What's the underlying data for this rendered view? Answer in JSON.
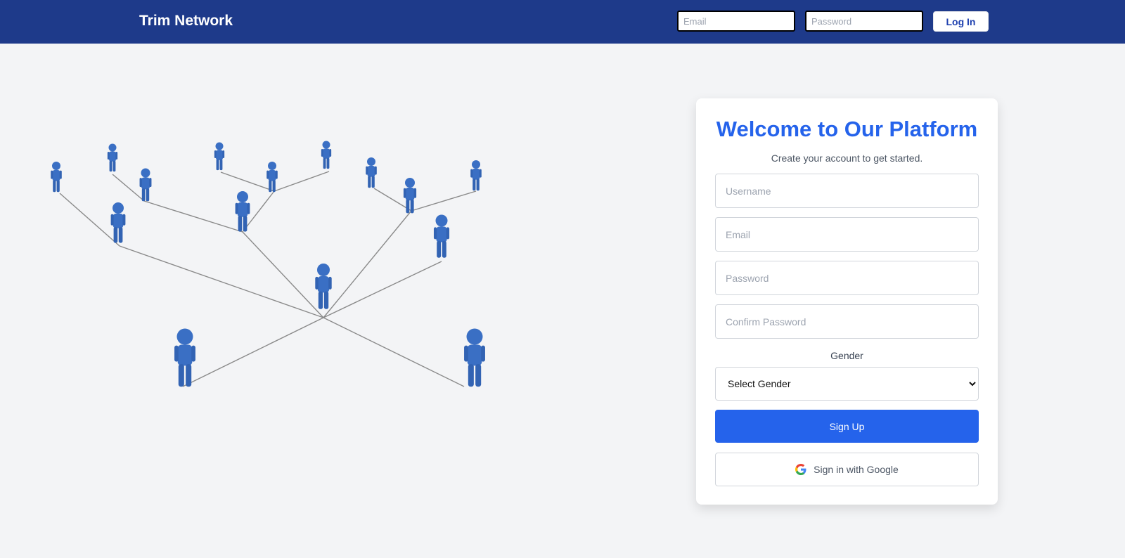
{
  "header": {
    "brand": "Trim Network",
    "email_placeholder": "Email",
    "password_placeholder": "Password",
    "login_label": "Log In"
  },
  "signup": {
    "title": "Welcome to Our Platform",
    "subtitle": "Create your account to get started.",
    "username_placeholder": "Username",
    "email_placeholder": "Email",
    "password_placeholder": "Password",
    "confirm_placeholder": "Confirm Password",
    "gender_label": "Gender",
    "gender_selected": "Select Gender",
    "signup_label": "Sign Up",
    "google_label": "Sign in with Google",
    "google_icon": "google-icon"
  },
  "colors": {
    "navbar": "#1e3a8a",
    "primary": "#2563eb",
    "figure": "#3a6fc4"
  }
}
